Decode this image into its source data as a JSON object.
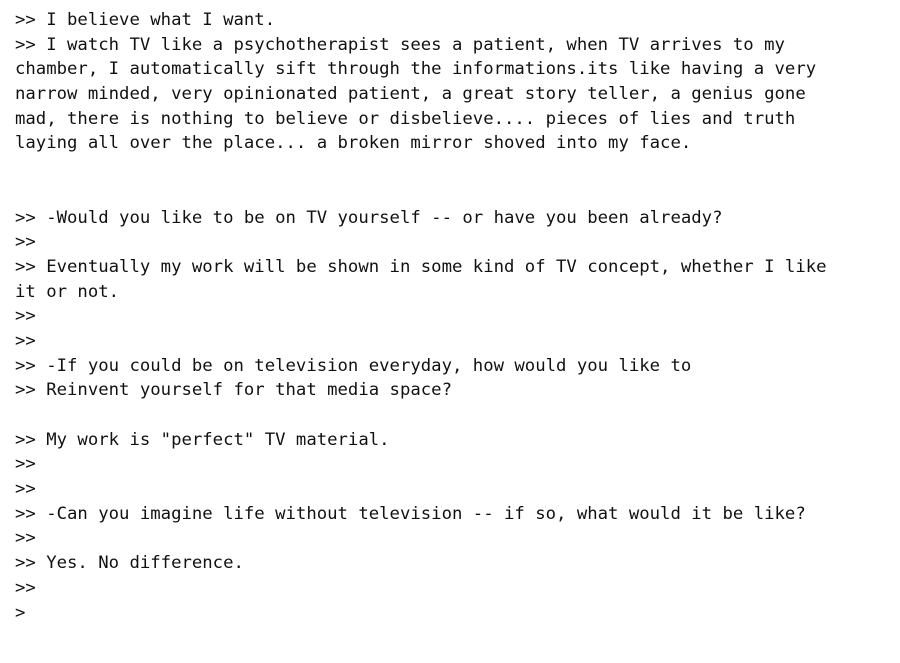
{
  "document": {
    "lines": [
      ">> I believe what I want.",
      ">> I watch TV like a psychotherapist sees a patient, when TV arrives to my",
      "chamber, I automatically sift through the informations.its like having a very",
      "narrow minded, very opinionated patient, a great story teller, a genius gone",
      "mad, there is nothing to believe or disbelieve.... pieces of lies and truth",
      "laying all over the place... a broken mirror shoved into my face.",
      "",
      "",
      ">> -Would you like to be on TV yourself -- or have you been already?",
      ">>",
      ">> Eventually my work will be shown in some kind of TV concept, whether I like",
      "it or not.",
      ">>",
      ">>",
      ">> -If you could be on television everyday, how would you like to",
      ">> Reinvent yourself for that media space?",
      "",
      ">> My work is \"perfect\" TV material.",
      ">>",
      ">>",
      ">> -Can you imagine life without television -- if so, what would it be like?",
      ">>",
      ">> Yes. No difference.",
      ">>",
      ">"
    ]
  }
}
